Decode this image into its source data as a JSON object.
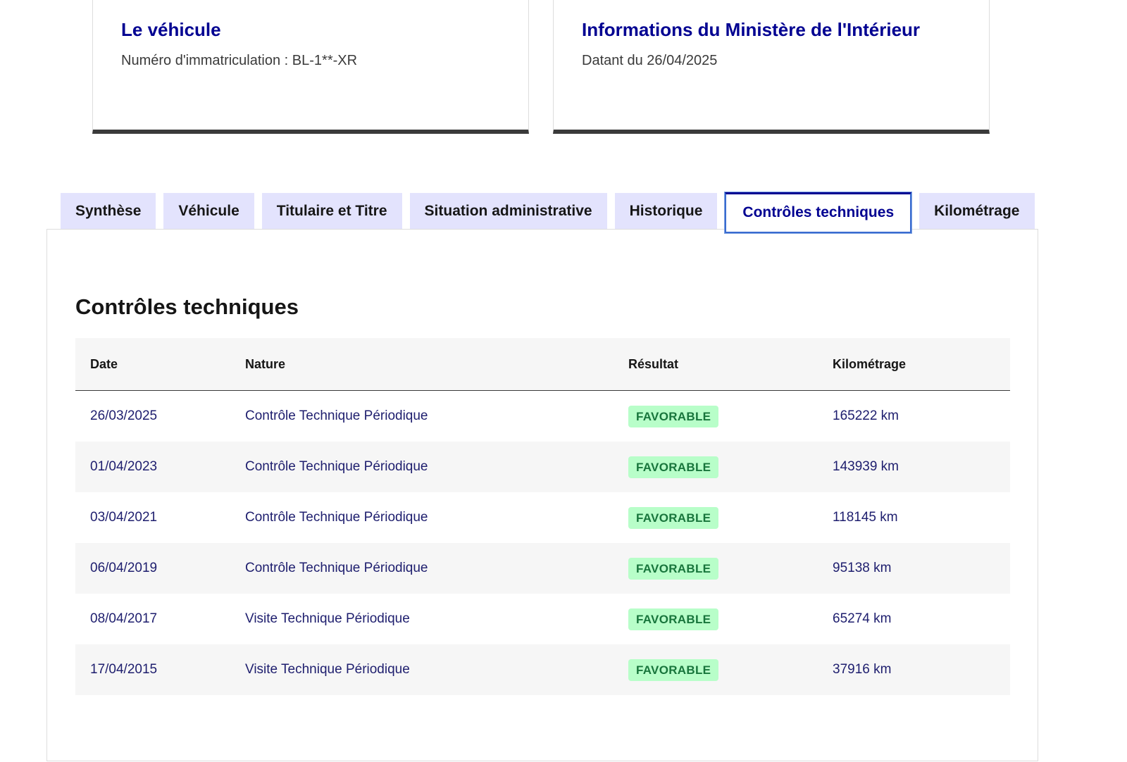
{
  "cards": {
    "vehicle": {
      "title": "Le véhicule",
      "subtitle": "Numéro d'immatriculation : BL-1**-XR"
    },
    "ministere": {
      "title": "Informations du Ministère de l'Intérieur",
      "subtitle": "Datant du 26/04/2025"
    }
  },
  "tabs": [
    {
      "label": "Synthèse"
    },
    {
      "label": "Véhicule"
    },
    {
      "label": "Titulaire et Titre"
    },
    {
      "label": "Situation administrative"
    },
    {
      "label": "Historique"
    },
    {
      "label": "Contrôles techniques"
    },
    {
      "label": "Kilométrage"
    }
  ],
  "active_tab": "Contrôles techniques",
  "panel": {
    "title": "Contrôles techniques",
    "columns": {
      "date": "Date",
      "nature": "Nature",
      "result": "Résultat",
      "km": "Kilométrage"
    },
    "rows": [
      {
        "date": "26/03/2025",
        "nature": "Contrôle Technique Périodique",
        "result": "FAVORABLE",
        "km": "165222 km"
      },
      {
        "date": "01/04/2023",
        "nature": "Contrôle Technique Périodique",
        "result": "FAVORABLE",
        "km": "143939 km"
      },
      {
        "date": "03/04/2021",
        "nature": "Contrôle Technique Périodique",
        "result": "FAVORABLE",
        "km": "118145 km"
      },
      {
        "date": "06/04/2019",
        "nature": "Contrôle Technique Périodique",
        "result": "FAVORABLE",
        "km": "95138 km"
      },
      {
        "date": "08/04/2017",
        "nature": "Visite Technique Périodique",
        "result": "FAVORABLE",
        "km": "65274 km"
      },
      {
        "date": "17/04/2015",
        "nature": "Visite Technique Périodique",
        "result": "FAVORABLE",
        "km": "37916 km"
      }
    ]
  },
  "colors": {
    "primary_blue": "#000091",
    "tab_background": "#e3e3fd",
    "badge_background": "#b8fec9",
    "badge_text": "#18753c"
  }
}
